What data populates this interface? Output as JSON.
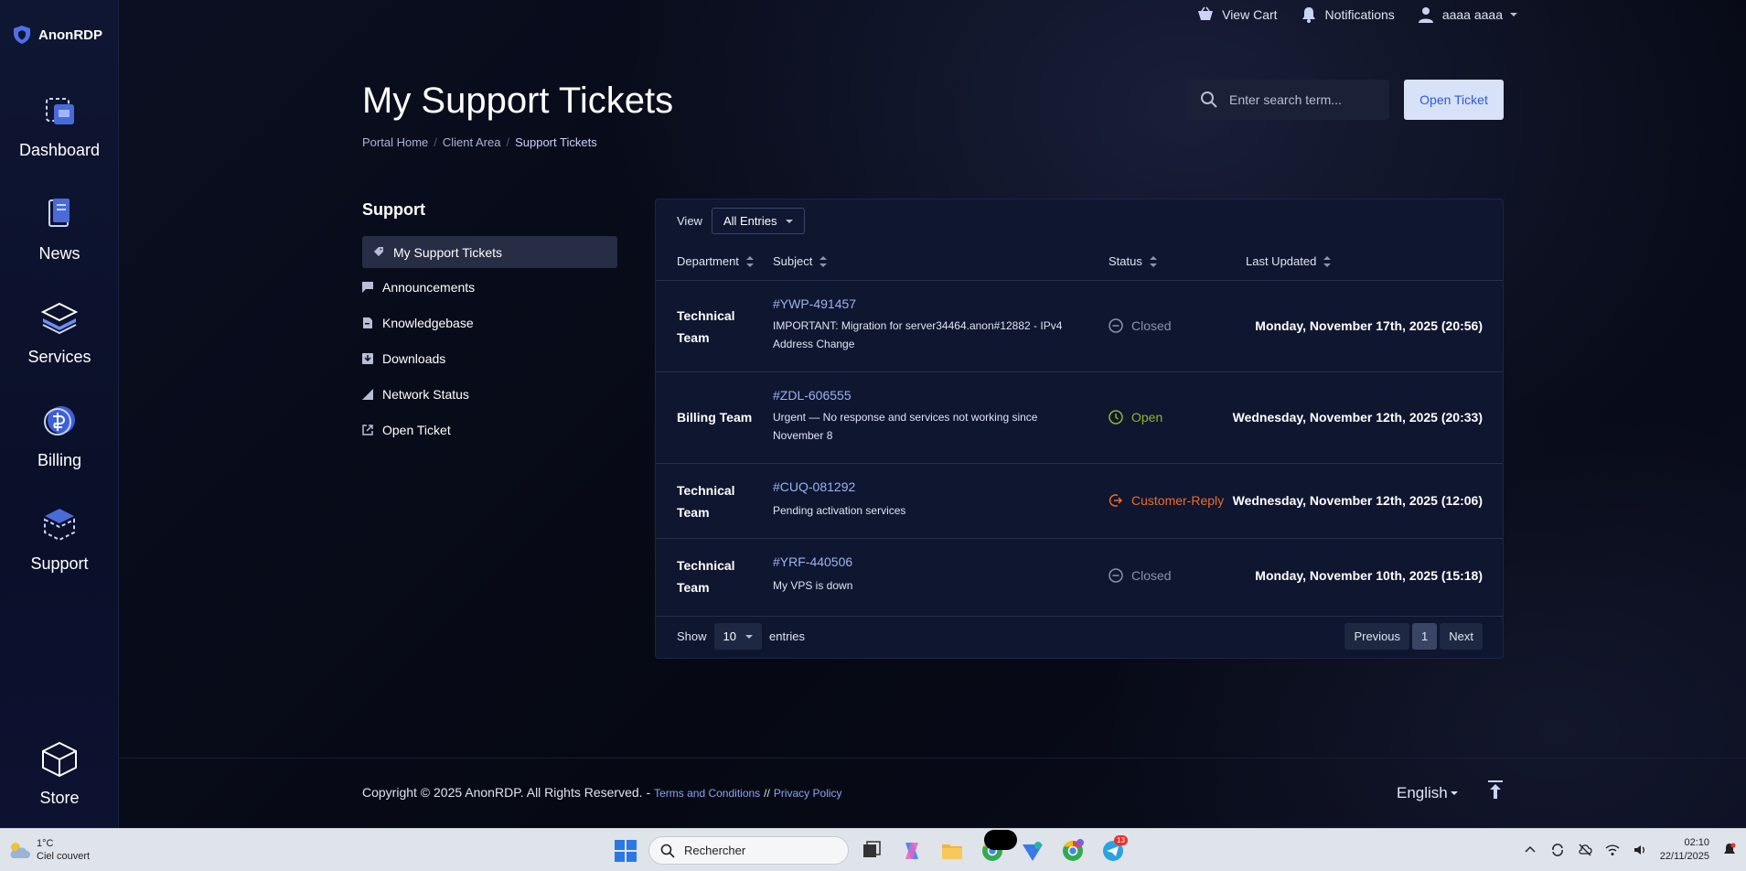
{
  "brand": {
    "name": "AnonRDP"
  },
  "sidebar": {
    "items": [
      {
        "label": "Dashboard",
        "icon": "dashboard-icon"
      },
      {
        "label": "News",
        "icon": "news-icon"
      },
      {
        "label": "Services",
        "icon": "services-stack-icon"
      },
      {
        "label": "Billing",
        "icon": "billing-icon"
      },
      {
        "label": "Support",
        "icon": "support-box-icon"
      },
      {
        "label": "Store",
        "icon": "store-cube-icon"
      }
    ]
  },
  "topbar": {
    "view_cart": "View Cart",
    "notifications": "Notifications",
    "user": "aaaa aaaa"
  },
  "header": {
    "title": "My Support Tickets",
    "breadcrumb": [
      "Portal Home",
      "Client Area",
      "Support Tickets"
    ],
    "search_placeholder": "Enter search term...",
    "open_ticket": "Open Ticket"
  },
  "support_nav": {
    "heading": "Support",
    "items": [
      {
        "label": "My Support Tickets",
        "icon": "ticket-icon"
      },
      {
        "label": "Announcements",
        "icon": "comment-icon"
      },
      {
        "label": "Knowledgebase",
        "icon": "book-icon"
      },
      {
        "label": "Downloads",
        "icon": "download-icon"
      },
      {
        "label": "Network Status",
        "icon": "signal-icon"
      },
      {
        "label": "Open Ticket",
        "icon": "external-link-icon"
      }
    ]
  },
  "table": {
    "view_label": "View",
    "view_value": "All Entries",
    "columns": [
      "Department",
      "Subject",
      "Status",
      "Last Updated"
    ],
    "rows": [
      {
        "department": "Technical Team",
        "id": "#YWP-491457",
        "subject": "IMPORTANT: Migration for server34464.anon#12882 - IPv4 Address Change",
        "status": "Closed",
        "last_updated": "Monday, November 17th, 2025 (20:56)"
      },
      {
        "department": "Billing Team",
        "id": "#ZDL-606555",
        "subject": "Urgent — No response and services not working since November 8",
        "status": "Open",
        "last_updated": "Wednesday, November 12th, 2025 (20:33)"
      },
      {
        "department": "Technical Team",
        "id": "#CUQ-081292",
        "subject": "Pending activation services",
        "status": "Customer-Reply",
        "last_updated": "Wednesday, November 12th, 2025 (12:06)"
      },
      {
        "department": "Technical Team",
        "id": "#YRF-440506",
        "subject": "My VPS is down",
        "status": "Closed",
        "last_updated": "Monday, November 10th, 2025 (15:18)"
      }
    ],
    "show_label": "Show",
    "show_value": "10",
    "entries_label": "entries",
    "pagination": {
      "previous": "Previous",
      "current": "1",
      "next": "Next"
    }
  },
  "colors": {
    "accent": "#d7e1f7",
    "status_closed": "#8d93a8",
    "status_open": "#8fb62a",
    "status_customer_reply": "#f06a28"
  },
  "footer": {
    "copyright": "Copyright © 2025 AnonRDP. All Rights Reserved. -",
    "terms": "Terms and Conditions",
    "separator": "//",
    "privacy": "Privacy Policy",
    "language": "English"
  },
  "taskbar": {
    "temperature": "1°C",
    "weather": "Ciel couvert",
    "search_placeholder": "Rechercher",
    "notification_badge": "13",
    "time": "02:10",
    "date": "22/11/2025"
  }
}
